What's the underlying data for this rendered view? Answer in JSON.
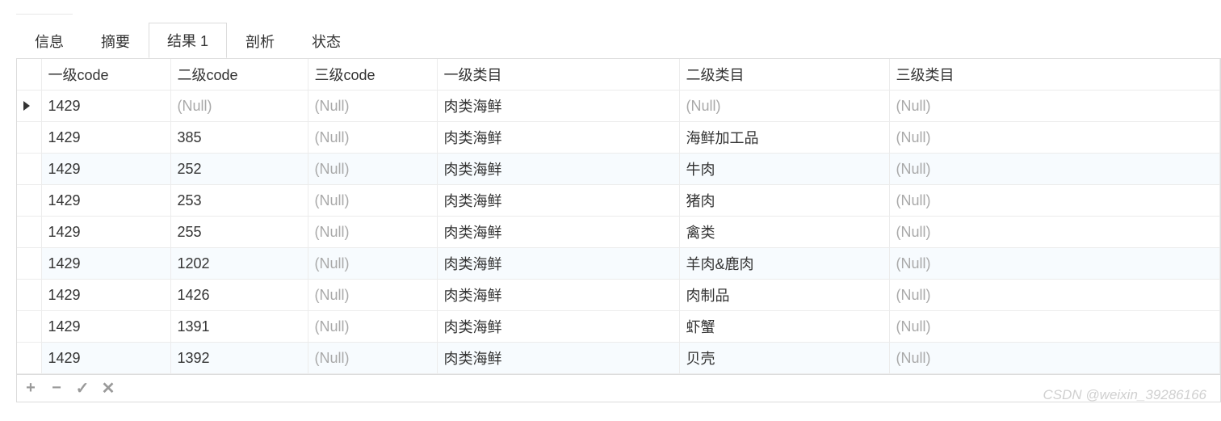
{
  "tabs": [
    {
      "label": "信息",
      "active": false
    },
    {
      "label": "摘要",
      "active": false
    },
    {
      "label": "结果 1",
      "active": true
    },
    {
      "label": "剖析",
      "active": false
    },
    {
      "label": "状态",
      "active": false
    }
  ],
  "null_text": "(Null)",
  "columns": [
    "一级code",
    "二级code",
    "三级code",
    "一级类目",
    "二级类目",
    "三级类目"
  ],
  "selected_col": 0,
  "current_row": 0,
  "rows": [
    {
      "c0": "1429",
      "c1": null,
      "c2": null,
      "c3": "肉类海鲜",
      "c4": null,
      "c5": null
    },
    {
      "c0": "1429",
      "c1": "385",
      "c2": null,
      "c3": "肉类海鲜",
      "c4": "海鲜加工品",
      "c5": null
    },
    {
      "c0": "1429",
      "c1": "252",
      "c2": null,
      "c3": "肉类海鲜",
      "c4": "牛肉",
      "c5": null
    },
    {
      "c0": "1429",
      "c1": "253",
      "c2": null,
      "c3": "肉类海鲜",
      "c4": "猪肉",
      "c5": null
    },
    {
      "c0": "1429",
      "c1": "255",
      "c2": null,
      "c3": "肉类海鲜",
      "c4": "禽类",
      "c5": null
    },
    {
      "c0": "1429",
      "c1": "1202",
      "c2": null,
      "c3": "肉类海鲜",
      "c4": "羊肉&鹿肉",
      "c5": null
    },
    {
      "c0": "1429",
      "c1": "1426",
      "c2": null,
      "c3": "肉类海鲜",
      "c4": "肉制品",
      "c5": null
    },
    {
      "c0": "1429",
      "c1": "1391",
      "c2": null,
      "c3": "肉类海鲜",
      "c4": "虾蟹",
      "c5": null
    },
    {
      "c0": "1429",
      "c1": "1392",
      "c2": null,
      "c3": "肉类海鲜",
      "c4": "贝壳",
      "c5": null
    }
  ],
  "footer_icons": [
    "+",
    "−",
    "✓",
    "✕"
  ],
  "watermark": "CSDN @weixin_39286166"
}
